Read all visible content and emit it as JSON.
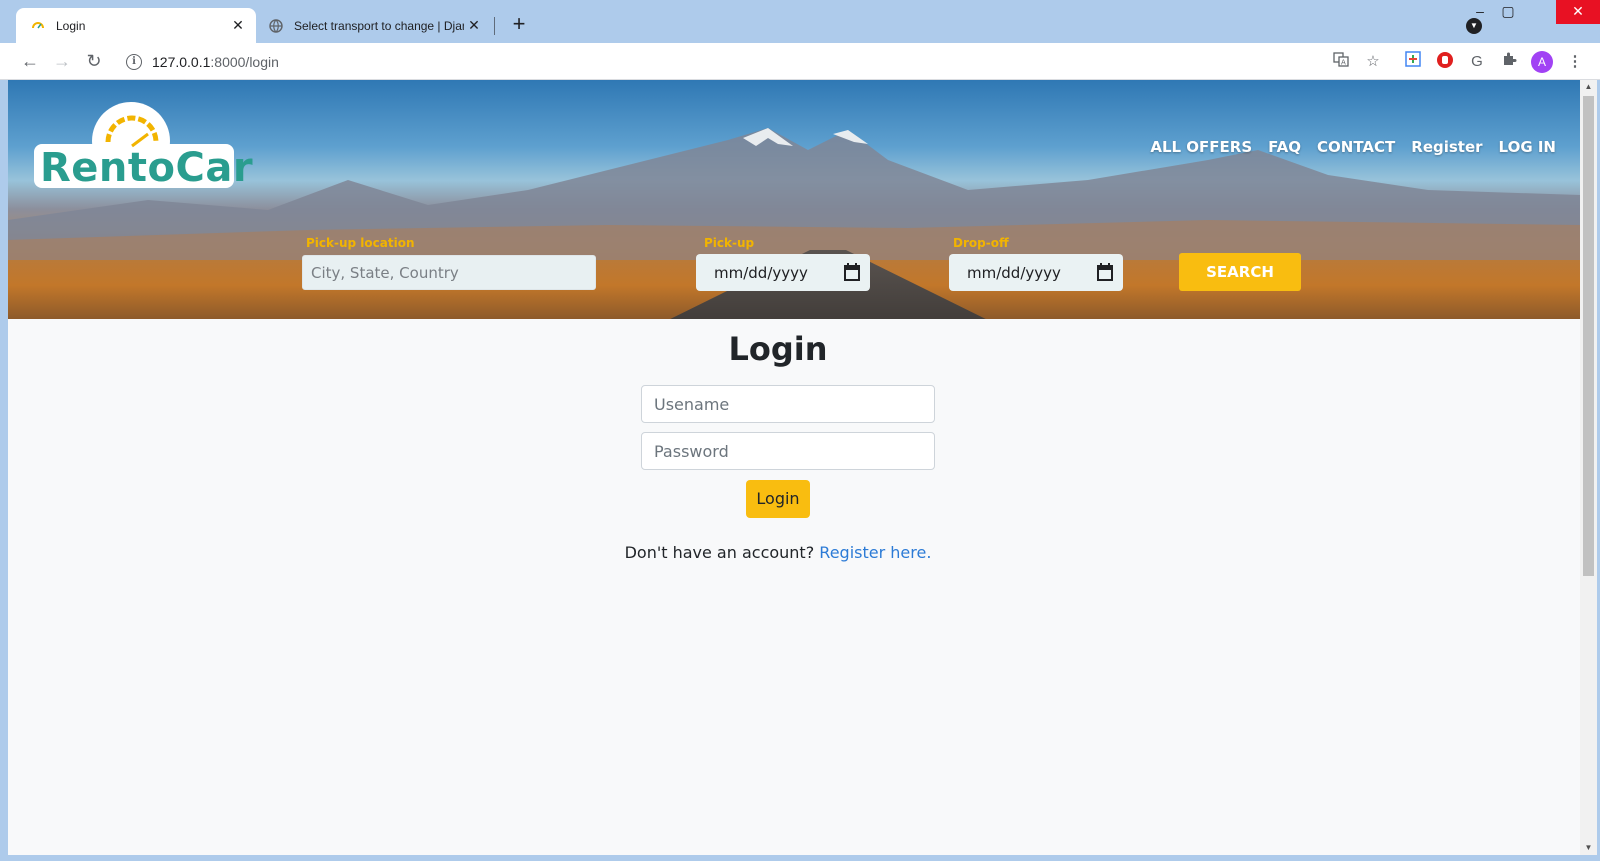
{
  "browser": {
    "tabs": [
      {
        "title": "Login",
        "active": true
      },
      {
        "title": "Select transport to change | Djan",
        "active": false
      }
    ],
    "url_host": "127.0.0.1",
    "url_path": ":8000/login",
    "profile_initial": "A"
  },
  "site": {
    "logo_text": "RentoCar",
    "nav": [
      "ALL OFFERS",
      "FAQ",
      "CONTACT",
      "Register",
      "LOG IN"
    ],
    "search": {
      "location_label": "Pick-up location",
      "location_placeholder": "City, State, Country",
      "pickup_label": "Pick-up",
      "pickup_value": "mm/dd/yyyy",
      "dropoff_label": "Drop-off",
      "dropoff_value": "mm/dd/yyyy",
      "button": "SEARCH"
    }
  },
  "login": {
    "title": "Login",
    "username_placeholder": "Usename",
    "password_placeholder": "Password",
    "button": "Login",
    "no_account_text": "Don't have an account?",
    "register_link": "Register here."
  },
  "colors": {
    "accent": "#f9bd10",
    "logo_teal": "#2a9d8f",
    "link": "#2c7bd6"
  }
}
